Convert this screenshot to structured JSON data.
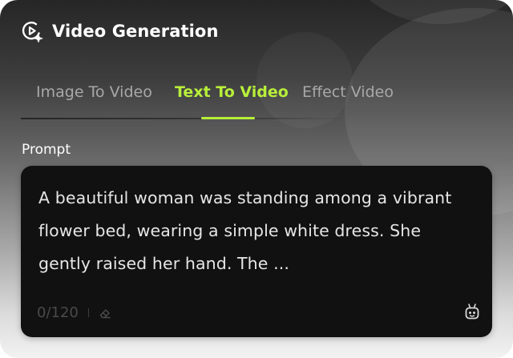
{
  "header": {
    "title": "Video Generation",
    "icon": "video-sparkle-icon"
  },
  "tabs": [
    {
      "label": "Image To Video",
      "active": false
    },
    {
      "label": "Text To Video",
      "active": true
    },
    {
      "label": "Effect Video",
      "active": false
    }
  ],
  "prompt": {
    "label": "Prompt",
    "text": "A beautiful woman was standing among a vibrant flower bed, wearing a simple white dress. She gently raised her hand. The ...",
    "counter": "0/120",
    "clear_icon": "eraser-icon",
    "assistant_icon": "robot-icon"
  },
  "colors": {
    "accent": "#b8ef3a",
    "text_box_bg": "#111111",
    "inactive_tab": "#a8a8a8"
  }
}
